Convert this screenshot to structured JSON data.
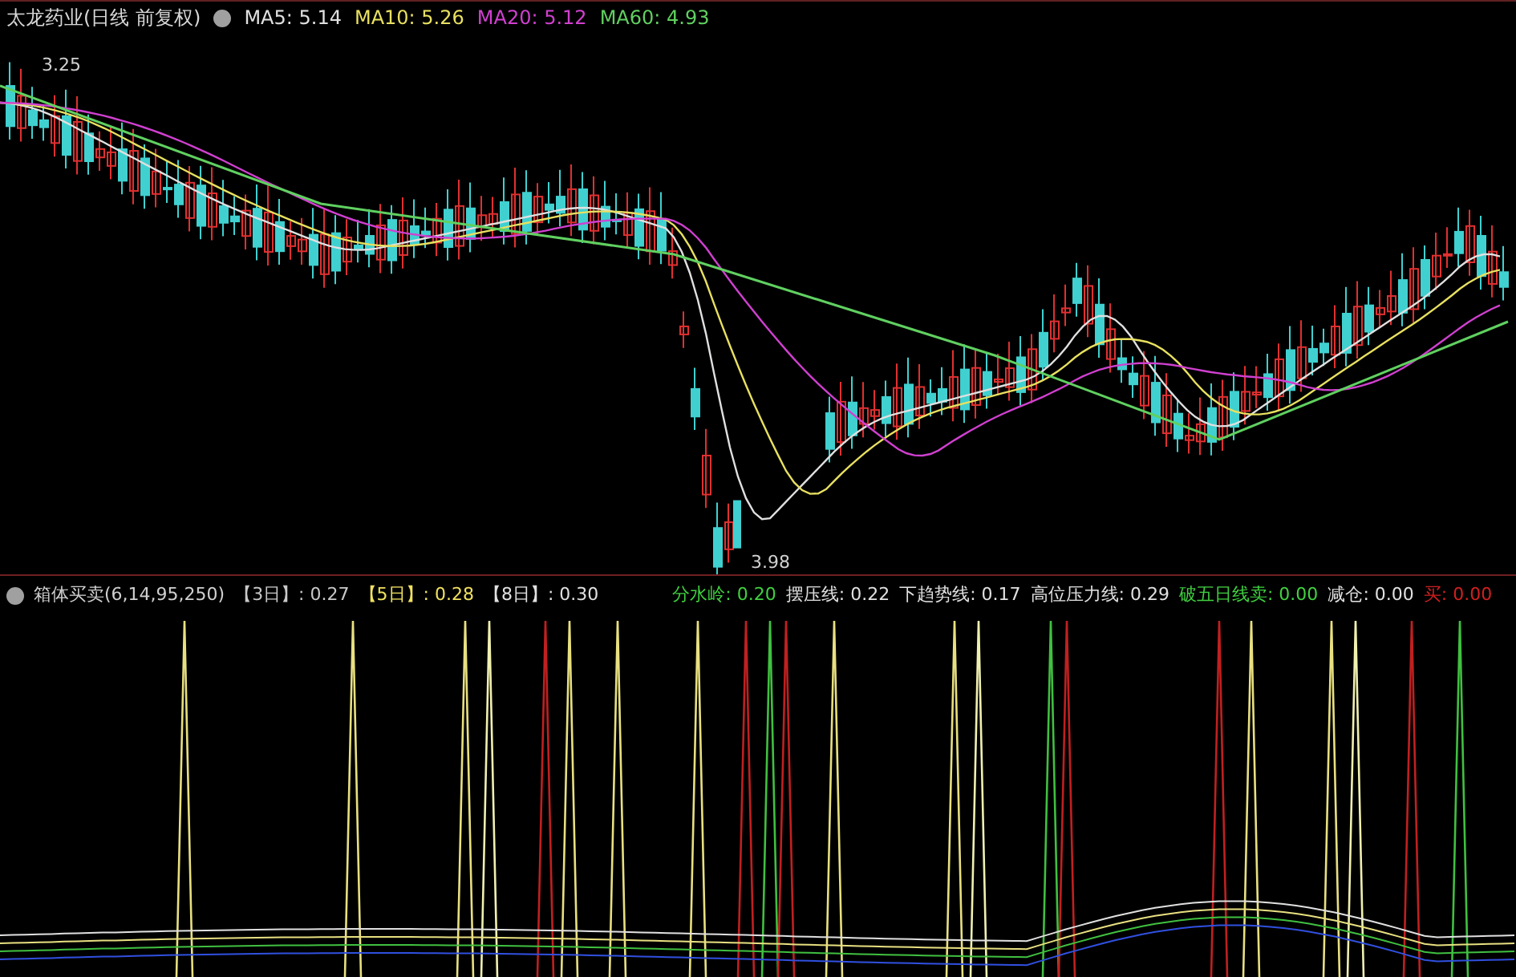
{
  "title": "太龙药业(日线 前复权)",
  "ma_legend": [
    {
      "text": "MA5: 5.14",
      "color": "#e0e0e0"
    },
    {
      "text": "MA10: 5.26",
      "color": "#e8e060"
    },
    {
      "text": "MA20: 5.12",
      "color": "#d040d0"
    },
    {
      "text": "MA60: 4.93",
      "color": "#60d060"
    }
  ],
  "price_labels": [
    {
      "text": "3.25"
    },
    {
      "text": "3.98"
    }
  ],
  "indicator_title": "箱体买卖(6,14,95,250)",
  "indicator_legend": [
    {
      "text": "【3日】: 0.27",
      "color": "#c8c8c8"
    },
    {
      "text": "【5日】: 0.28",
      "color": "#f0e060"
    },
    {
      "text": "【8日】: 0.30",
      "color": "#e0e0e0"
    },
    {
      "text": "分水岭: 0.20",
      "color": "#40d040"
    },
    {
      "text": "摆压线: 0.22",
      "color": "#e0e0e0"
    },
    {
      "text": "下趋势线: 0.17",
      "color": "#e0e0e0"
    },
    {
      "text": "高位压力线: 0.29",
      "color": "#e0e0e0"
    },
    {
      "text": "破五日线卖: 0.00",
      "color": "#40d040"
    },
    {
      "text": "减仓: 0.00",
      "color": "#e0e0e0"
    },
    {
      "text": "买: 0.00",
      "color": "#d02020"
    }
  ]
}
